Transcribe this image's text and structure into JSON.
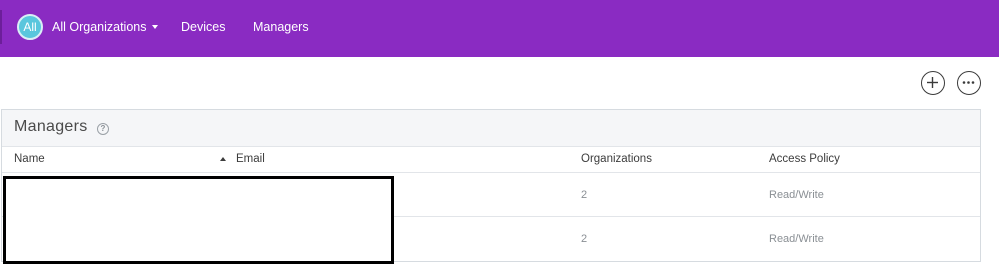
{
  "header": {
    "org_avatar_text": "All",
    "org_switcher_label": "All Organizations",
    "nav": [
      {
        "label": "Devices"
      },
      {
        "label": "Managers"
      }
    ],
    "brand_color": "#8a2bc2",
    "avatar_color": "#59c6dd"
  },
  "actions": {
    "add_icon": "plus-circle-icon",
    "more_icon": "ellipsis-circle-icon"
  },
  "panel": {
    "title": "Managers",
    "help_glyph": "?",
    "columns": {
      "name": "Name",
      "email": "Email",
      "organizations": "Organizations",
      "access_policy": "Access Policy"
    },
    "sort": {
      "column": "name",
      "direction": "ascending"
    },
    "rows": [
      {
        "organizations": "2",
        "access_policy": "Read/Write"
      },
      {
        "organizations": "2",
        "access_policy": "Read/Write"
      }
    ]
  }
}
